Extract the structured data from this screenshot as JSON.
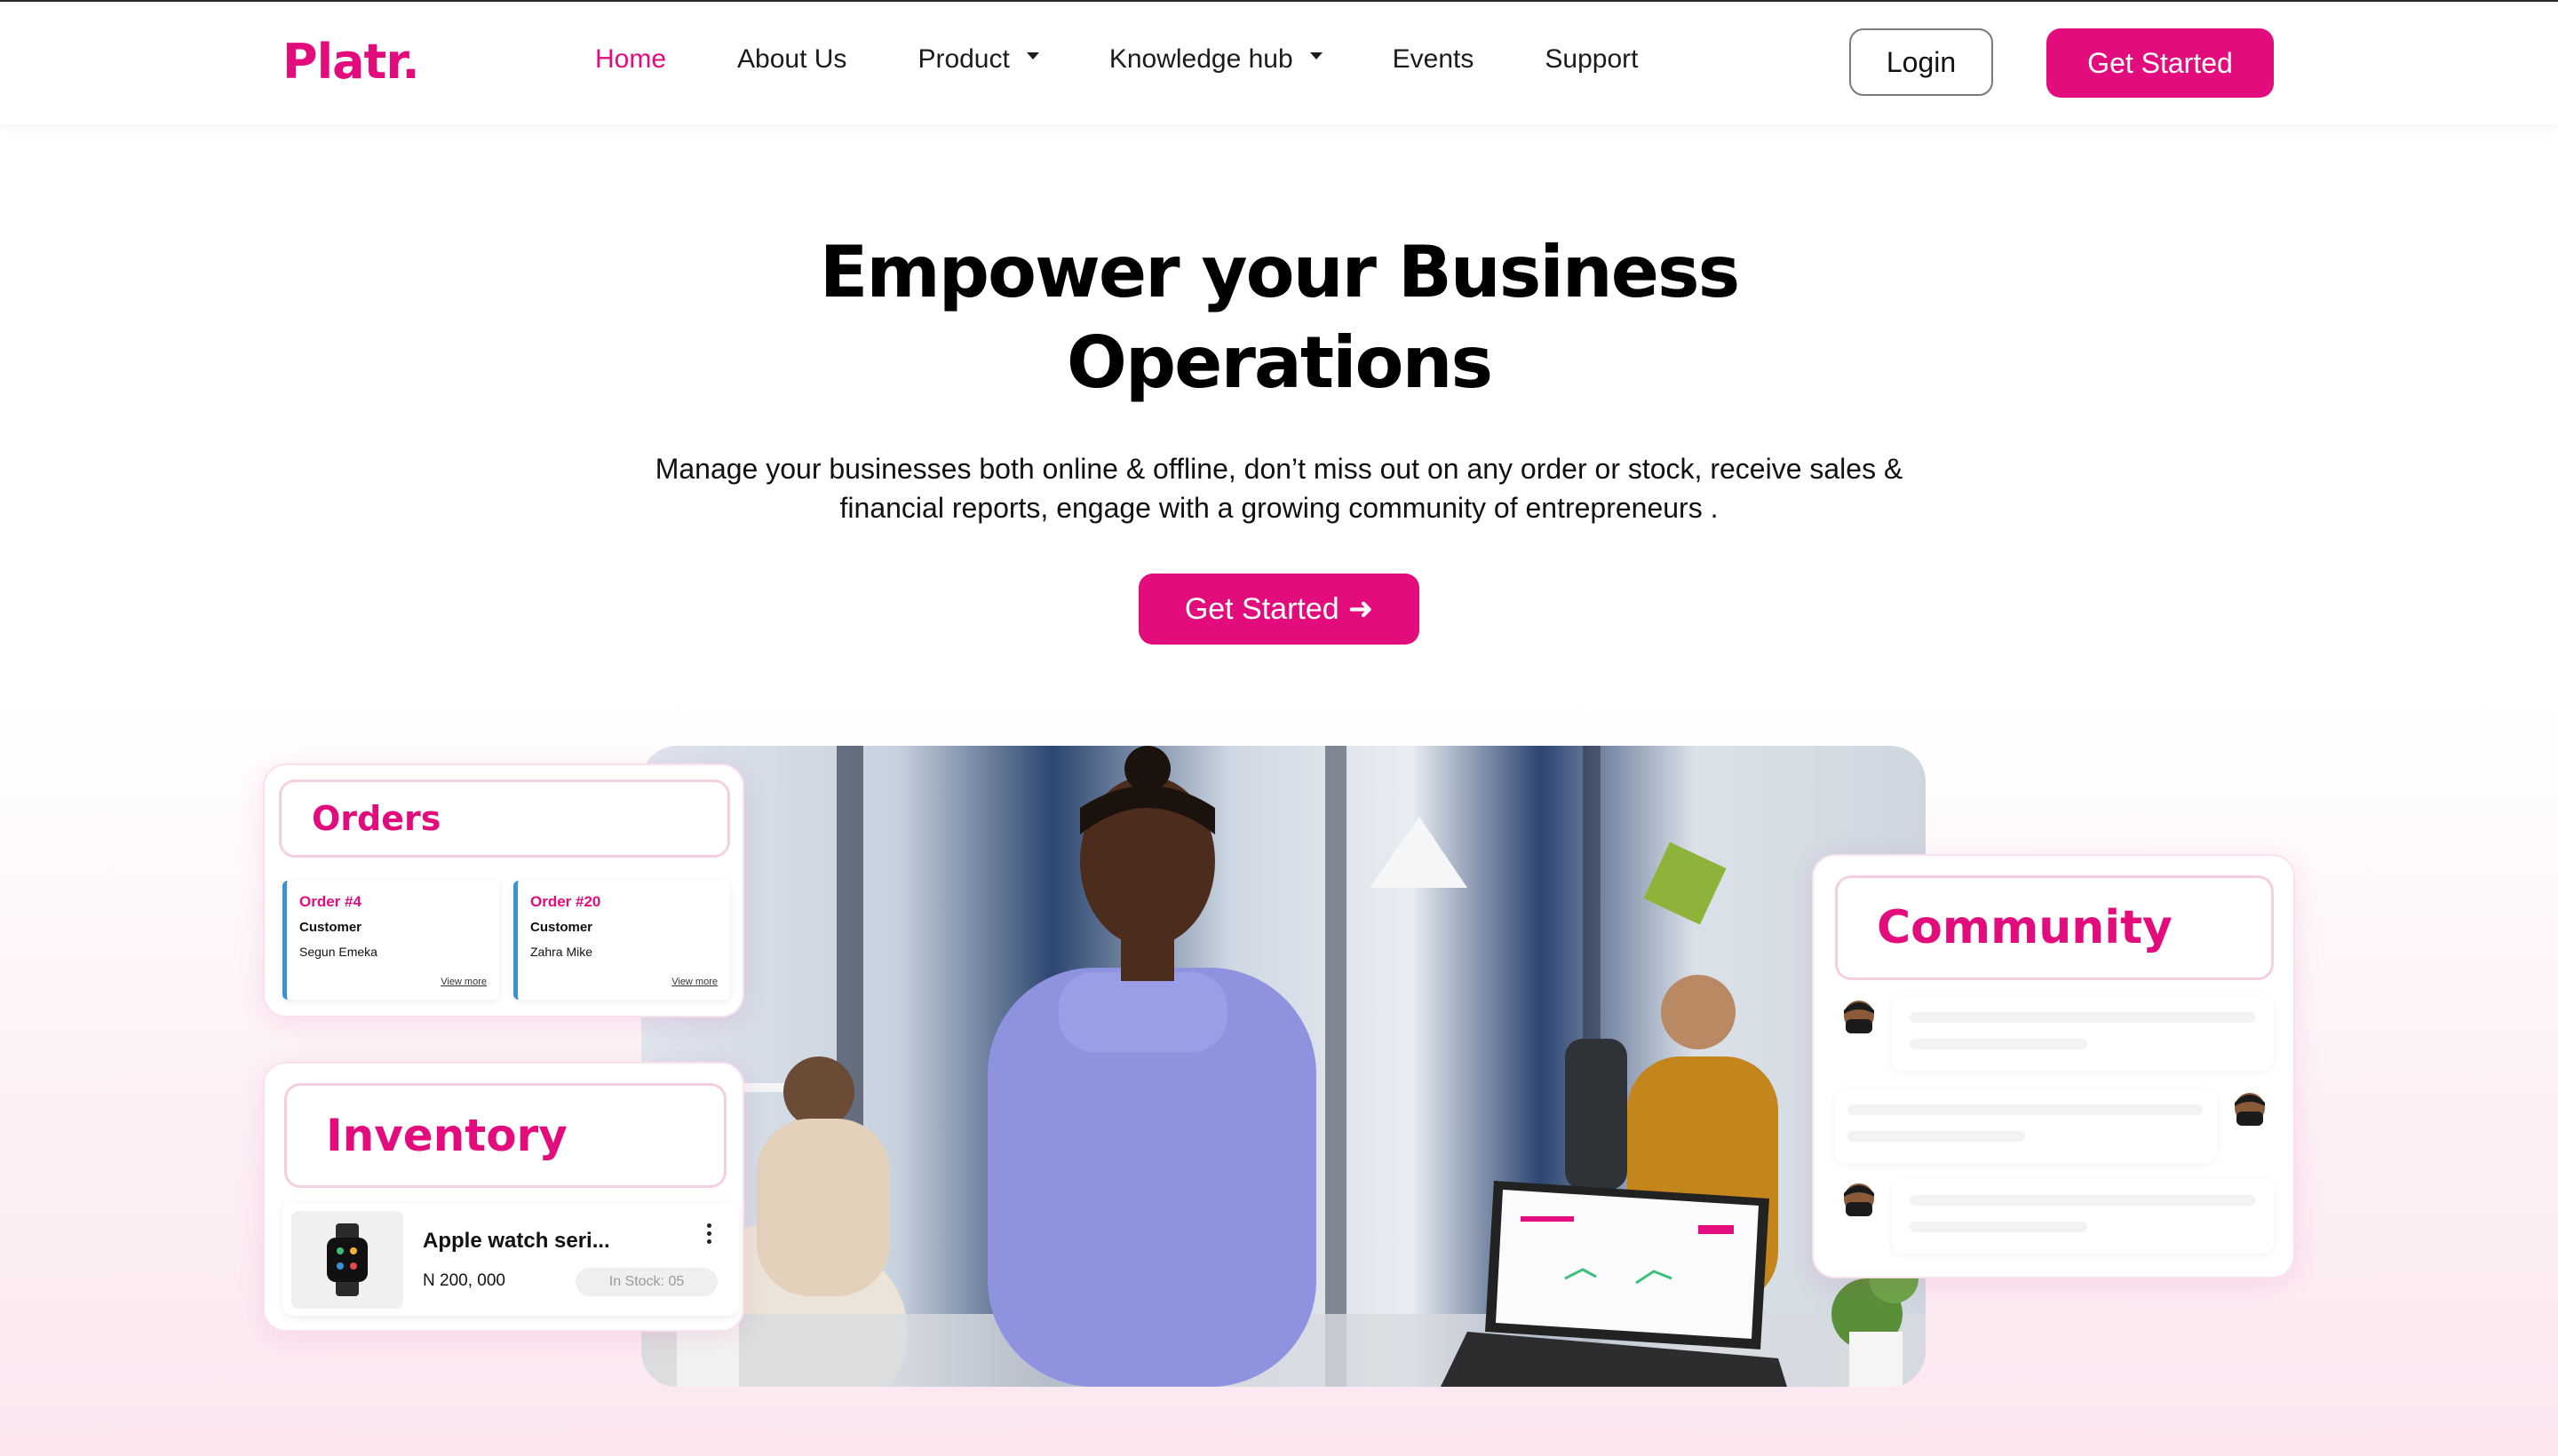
{
  "nav": {
    "logo": "Platr.",
    "links": [
      {
        "label": "Home",
        "active": true
      },
      {
        "label": "About Us"
      },
      {
        "label": "Product",
        "dropdown": true
      },
      {
        "label": "Knowledge hub",
        "dropdown": true
      },
      {
        "label": "Events"
      },
      {
        "label": "Support"
      }
    ],
    "login_label": "Login",
    "get_started_label": "Get Started"
  },
  "hero": {
    "title_line1": "Empower your Business",
    "title_line2": "Operations",
    "subtitle_line1": "Manage your businesses both online & offline, don’t miss out on any order or stock, receive sales &",
    "subtitle_line2": "financial reports, engage with a growing community of entrepreneurs .",
    "cta_label": "Get Started",
    "cta_icon": "arrow-right-icon"
  },
  "orders_card": {
    "title": "Orders",
    "orders": [
      {
        "title": "Order #4",
        "customer_label": "Customer",
        "customer": "Segun Emeka",
        "link": "View more"
      },
      {
        "title": "Order #20",
        "customer_label": "Customer",
        "customer": "Zahra Mike",
        "link": "View more"
      }
    ]
  },
  "inventory_card": {
    "title": "Inventory",
    "item": {
      "name": "Apple watch seri...",
      "price": "N 200, 000",
      "stock": "In Stock: 05"
    }
  },
  "community_card": {
    "title": "Community"
  },
  "colors": {
    "brand": "#e20c7c",
    "text": "#111111"
  }
}
